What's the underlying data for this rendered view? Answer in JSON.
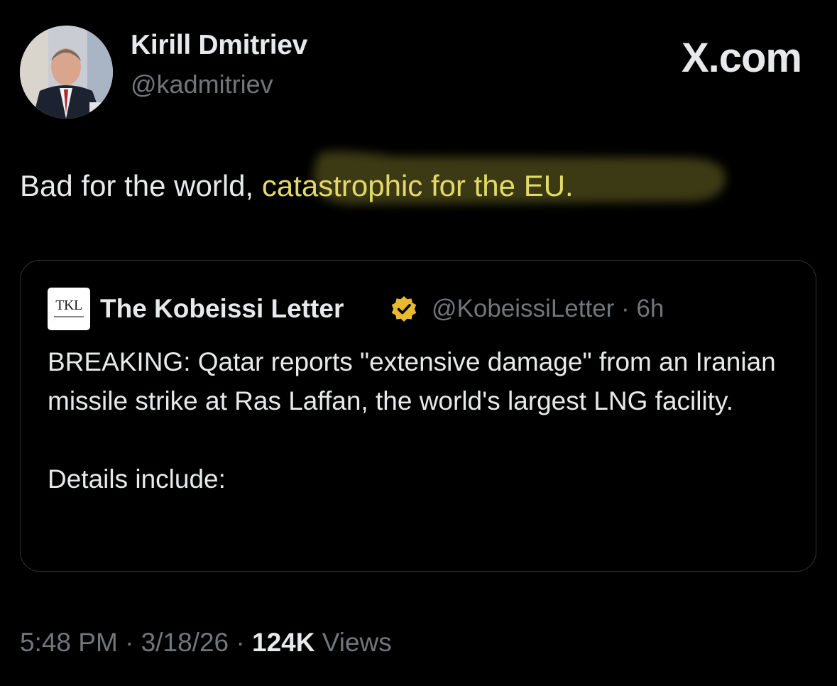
{
  "author": {
    "name": "Kirill Dmitriev",
    "handle": "@kadmitriev"
  },
  "brand": {
    "label": "X.com"
  },
  "tweet": {
    "text_plain": "Bad for the world, ",
    "text_highlighted": "catastrophic for the EU.",
    "highlight_color": "#e3d96a"
  },
  "quoted_tweet": {
    "logo_text": "TKL",
    "name": "The Kobeissi Letter",
    "verified_badge": "gold-verified-badge-icon",
    "verified_color": "#e8b931",
    "handle_time": "@KobeissiLetter · 6h",
    "body_paragraph_1": "BREAKING: Qatar reports \"extensive damage\" from an Iranian missile strike at Ras Laffan, the world's largest LNG facility.",
    "body_paragraph_2": "Details include:"
  },
  "meta": {
    "timestamp": "5:48 PM · 3/18/26 · ",
    "views_count": "124K",
    "views_label": " Views"
  },
  "colors": {
    "background": "#000000",
    "text_primary": "#e7e9ea",
    "text_secondary": "#71767b",
    "border": "#2f3336"
  }
}
